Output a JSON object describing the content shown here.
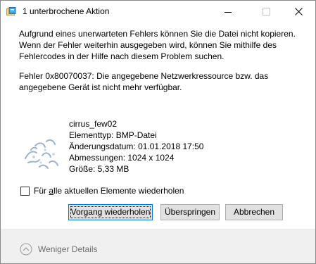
{
  "window": {
    "title": "1 unterbrochene Aktion"
  },
  "message": {
    "main": "Aufgrund eines unerwarteten Fehlers können Sie die Datei nicht kopieren.\nWenn der Fehler weiterhin ausgegeben wird, können Sie mithilfe des\nFehlercodes in der Hilfe nach diesem Problem suchen.",
    "error": "Fehler 0x80070037: Die angegebene Netzwerkressource bzw. das\nangegebene Gerät ist nicht mehr verfügbar."
  },
  "file": {
    "name": "cirrus_few02",
    "type": "Elementtyp: BMP-Datei",
    "modified": "Änderungsdatum: 01.01.2018 17:50",
    "dimensions": "Abmessungen: 1024 x 1024",
    "size": "Größe: 5,33 MB"
  },
  "checkbox": {
    "label_prefix": "Für ",
    "label_accel": "a",
    "label_rest": "lle aktuellen Elemente wiederholen",
    "checked": false
  },
  "buttons": {
    "retry": "Vorgang wiederholen",
    "skip": "Überspringen",
    "cancel": "Abbrechen"
  },
  "footer": {
    "less_details": "Weniger Details"
  },
  "icons": {
    "app": "copy-error-icon",
    "minimize": "minimize-icon",
    "maximize": "maximize-icon",
    "close": "close-icon",
    "collapse": "chevron-up-circle-icon"
  }
}
